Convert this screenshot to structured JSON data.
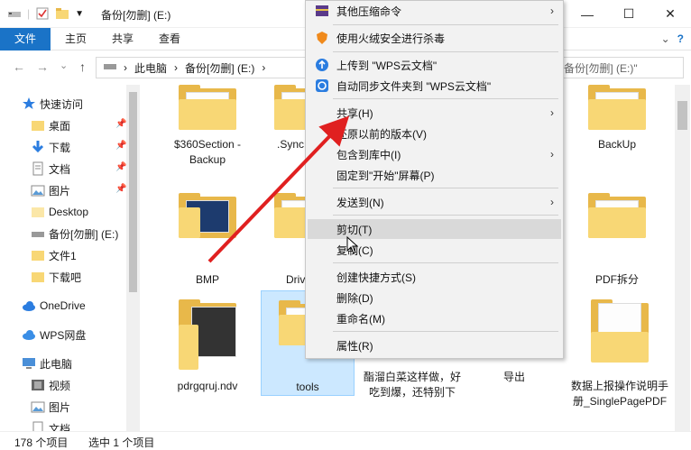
{
  "titlebar": {
    "title": "备份[勿删] (E:)",
    "minimize": "—",
    "maximize": "☐",
    "close": "✕"
  },
  "ribbon": {
    "tabs": [
      "文件",
      "主页",
      "共享",
      "查看"
    ],
    "collapse": "⌄",
    "help": "?"
  },
  "address": {
    "back": "←",
    "forward": "→",
    "recent": "⌄",
    "up": "↑",
    "parts": [
      "此电脑",
      "备份[勿删] (E:)"
    ],
    "sep": "›",
    "search_placeholder": "备份[勿删] (E:)\""
  },
  "nav": {
    "items": [
      {
        "label": "快速访问",
        "icon": "star-icon"
      },
      {
        "label": "桌面",
        "icon": "folder-icon",
        "pinned": true
      },
      {
        "label": "下载",
        "icon": "download-icon",
        "pinned": true
      },
      {
        "label": "文档",
        "icon": "document-icon",
        "pinned": true
      },
      {
        "label": "图片",
        "icon": "picture-icon",
        "pinned": true
      },
      {
        "label": "Desktop",
        "icon": "folder-icon"
      },
      {
        "label": "备份[勿删] (E:)",
        "icon": "drive-icon"
      },
      {
        "label": "文件1",
        "icon": "folder-icon"
      },
      {
        "label": "下载吧",
        "icon": "folder-icon"
      },
      {
        "label": "OneDrive",
        "icon": "cloud-icon"
      },
      {
        "label": "WPS网盘",
        "icon": "cloud-icon"
      },
      {
        "label": "此电脑",
        "icon": "computer-icon"
      },
      {
        "label": "视频",
        "icon": "video-icon"
      },
      {
        "label": "图片",
        "icon": "picture-icon"
      },
      {
        "label": "文档",
        "icon": "document-icon"
      }
    ]
  },
  "files": [
    {
      "name": "$360Section - Backup"
    },
    {
      "name": ".SyncF His"
    },
    {
      "name": "BackUp"
    },
    {
      "name": "BMP"
    },
    {
      "name": "Drivers"
    },
    {
      "name": "PDF拆分"
    },
    {
      "name": "pdrgqruj.ndv"
    },
    {
      "name": "tools"
    },
    {
      "name": "酯溜白菜这样做，好吃到爆，还特别下"
    },
    {
      "name": "导出"
    },
    {
      "name": "数据上报操作说明手册_SinglePagePDF"
    }
  ],
  "status": {
    "count": "178 个项目",
    "selected": "选中 1 个项目"
  },
  "menu": {
    "items": [
      {
        "label": "其他压缩命令",
        "icon": "archive-icon",
        "sub": "›"
      },
      {
        "label": "使用火绒安全进行杀毒",
        "icon": "shield-icon"
      },
      {
        "label": "上传到 \"WPS云文档\"",
        "icon": "upload-cloud-icon"
      },
      {
        "label": "自动同步文件夹到 \"WPS云文档\"",
        "icon": "sync-icon"
      },
      {
        "label": "共享(H)",
        "sub": "›"
      },
      {
        "label": "还原以前的版本(V)"
      },
      {
        "label": "包含到库中(I)",
        "sub": "›"
      },
      {
        "label": "固定到\"开始\"屏幕(P)"
      },
      {
        "label": "发送到(N)",
        "sub": "›"
      },
      {
        "label": "剪切(T)"
      },
      {
        "label": "复制(C)"
      },
      {
        "label": "创建快捷方式(S)"
      },
      {
        "label": "删除(D)"
      },
      {
        "label": "重命名(M)"
      },
      {
        "label": "属性(R)"
      }
    ]
  },
  "colors": {
    "accent": "#1a73c7",
    "folder": "#f8d775",
    "selection": "#cce8ff",
    "arrow": "#e02020"
  }
}
